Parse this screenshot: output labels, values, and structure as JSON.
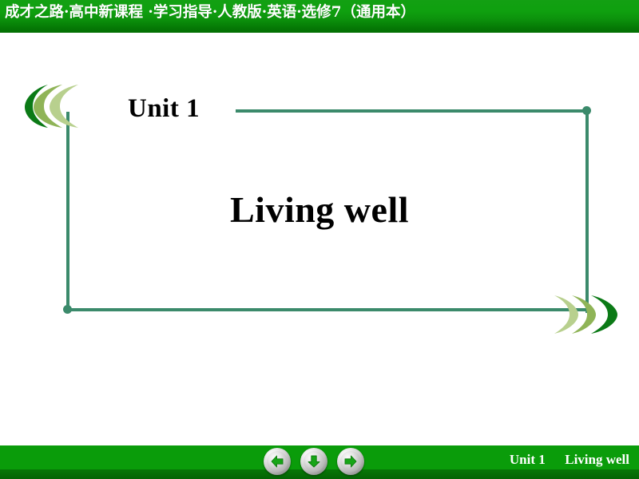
{
  "header": {
    "title": "成才之路·高中新课程 ·学习指导·人教版·英语·选修7（通用本）",
    "bg_color": "#0fa00f"
  },
  "slide": {
    "unit_label": "Unit 1",
    "main_title": "Living well",
    "background_color": "#ffffff",
    "frame_color": "#3b8a6b"
  },
  "decorations": {
    "left_chevrons": {
      "name": "left-chevron-cluster",
      "direction": "left",
      "colors": [
        "#0b7a16",
        "#8fb457",
        "#b8d08e"
      ]
    },
    "right_chevrons": {
      "name": "right-chevron-cluster",
      "direction": "right",
      "colors": [
        "#b8d08e",
        "#8fb457",
        "#0b7a16"
      ]
    }
  },
  "footer": {
    "unit_label": "Unit 1",
    "title": "Living well",
    "bg_color": "#0a9c0a",
    "buttons": [
      {
        "name": "previous-slide-button",
        "icon": "arrow-left-icon",
        "label": "Previous"
      },
      {
        "name": "down-slide-button",
        "icon": "arrow-down-icon",
        "label": "Down"
      },
      {
        "name": "next-slide-button",
        "icon": "arrow-right-icon",
        "label": "Next"
      }
    ]
  }
}
